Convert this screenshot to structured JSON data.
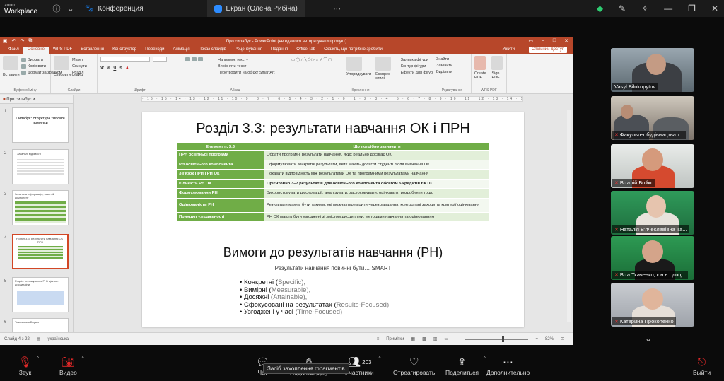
{
  "zoom": {
    "brand_top": "zoom",
    "brand_bottom": "Workplace",
    "tabs": [
      {
        "label": "Конференция"
      },
      {
        "label": "Екран (Олена Рибіна)"
      }
    ],
    "tooltip": "Засіб захоплення фрагментів"
  },
  "ppt": {
    "window_title": "Про силабус - PowerPoint (не вдалося авторизувати продукт)",
    "menu_tabs": [
      "Файл",
      "Основне",
      "WPS PDF",
      "Вставлення",
      "Конструктор",
      "Переходи",
      "Анімація",
      "Показ слайдів",
      "Рецензування",
      "Подання",
      "Office Tab",
      "Скажіть, що потрібно зробити."
    ],
    "user": "Увійти",
    "share": "Спільний доступ",
    "ribbon_groups": [
      {
        "name": "Буфер обміну",
        "items": [
          "Вставити",
          "Вирізати",
          "Копіювати",
          "Формат за зразком"
        ]
      },
      {
        "name": "Слайди",
        "items": [
          "Створити слайд",
          "Макет",
          "Скинути",
          "Розділ"
        ]
      },
      {
        "name": "Шрифт",
        "items": []
      },
      {
        "name": "Абзац",
        "items": [
          "Напрямок тексту",
          "Вирівняти текст",
          "Перетворити на об'єкт SmartArt"
        ]
      },
      {
        "name": "Креслення",
        "items": [
          "Упорядкувати",
          "Експрес-стилі",
          "Заливка фігури",
          "Контур фігури",
          "Ефекти для фігур"
        ]
      },
      {
        "name": "Редагування",
        "items": [
          "Знайти",
          "Замінити",
          "Виділити"
        ]
      },
      {
        "name": "WPS PDF",
        "items": [
          "Create PDF",
          "Sign PDF"
        ]
      }
    ],
    "panel_title": "Про силабус",
    "thumbnails": [
      {
        "num": "1",
        "text": "Силабус: структура типової помилки"
      },
      {
        "num": "2",
        "text": "Загальні відомості"
      },
      {
        "num": "3",
        "text": "Загальна інформація, освітній компонент"
      },
      {
        "num": "4",
        "text": "Розділ 3.3: результати навчання ОК і ПРН"
      },
      {
        "num": "5",
        "text": "Розділ: спрямування РН і цінності дисципліни"
      },
      {
        "num": "6",
        "text": "Таксономія Блума"
      }
    ],
    "ruler": "· 16 · 15 · 14 · 13 · 12 · 11 · 10 · 9 · 8 · 7 · 6 · 5 · 4 · 3 · 2 · 1 · 0 · 1 · 2 · 3 · 4 · 5 · 6 · 7 · 8 · 9 · 10 · 11 · 12 · 13 · 14 · 15 · 16 ·",
    "status_left": "Слайд 4 з 22",
    "status_lang": "українська",
    "status_notes": "Примітки",
    "status_zoom": "82%"
  },
  "slide": {
    "title": "Розділ 3.3: результати навчання ОК і ПРН",
    "table": {
      "headers": [
        "Елемент п. 3.3",
        "Що потрібно зазначити"
      ],
      "rows": [
        [
          "ПРН освітньої програми",
          "Обрати програмні результати навчання, яких реально досягає ОК"
        ],
        [
          "РН освітнього компонента",
          "Сформулювати конкретні результати, яких мають досягти студенті після вивчення ОК"
        ],
        [
          "Зв'язок ПРН і РН ОК",
          "Показати відповідність між результатами ОК та програмними результатами навчання"
        ],
        [
          "Кількість РН ОК",
          "Орієнтовно 3–7 результатів для освітнього компонента обсягом 5 кредитів ЄКТС"
        ],
        [
          "Формулювання РН",
          "Використовувати дієслова дії: аналізувати, застосовувати, оцінювати, розробляти тощо"
        ],
        [
          "Оцінюваність РН",
          "Результати мають бути такими, які можна перевірити через завдання, контрольні заходи та критерії оцінювання"
        ],
        [
          "Принцип узгодженості",
          "РН ОК мають бути узгоджені зі змістом дисципліни, методами навчання та оцінюванням"
        ]
      ]
    },
    "subtitle": "Вимоги до результатів навчання (РН)",
    "lead": "Результати навчання повинні бути… SMART",
    "bullets": [
      {
        "main": "Конкретні (",
        "hl": "S",
        "rest": "pecific),"
      },
      {
        "main": "Вимірні (",
        "hl": "M",
        "rest": "easurable),"
      },
      {
        "main": "Досяжні (",
        "hl": "A",
        "rest": "ttainable),"
      },
      {
        "main": "Сфокусовані на результатах (",
        "hl": "R",
        "rest": "esults-Focused),"
      },
      {
        "main": "Узгоджені у часі (",
        "hl": "T",
        "rest": "ime-Focused)"
      }
    ]
  },
  "participants": [
    {
      "name": "Vasyl Bilokopytov",
      "muted": false
    },
    {
      "name": "Факультет будівництва т...",
      "muted": true
    },
    {
      "name": "Віталій Бойко",
      "muted": true
    },
    {
      "name": "Наталія В'ячеславівна Та...",
      "muted": true
    },
    {
      "name": "Віта Ткаченко, к.н.н., доц...",
      "muted": true
    },
    {
      "name": "Катерина Прокопенко",
      "muted": true
    }
  ],
  "controls": {
    "audio": "Звук",
    "video": "Видео",
    "chat": "Чат",
    "raise": "Подняты руку",
    "participants": "Участники",
    "participants_count": "203",
    "react": "Отреагировать",
    "share": "Поделиться",
    "more": "Дополнительно",
    "leave": "Выйти"
  },
  "colors": {
    "ppt_red": "#b7472a",
    "table_green": "#70ad47",
    "zoom_red": "#e02828"
  }
}
